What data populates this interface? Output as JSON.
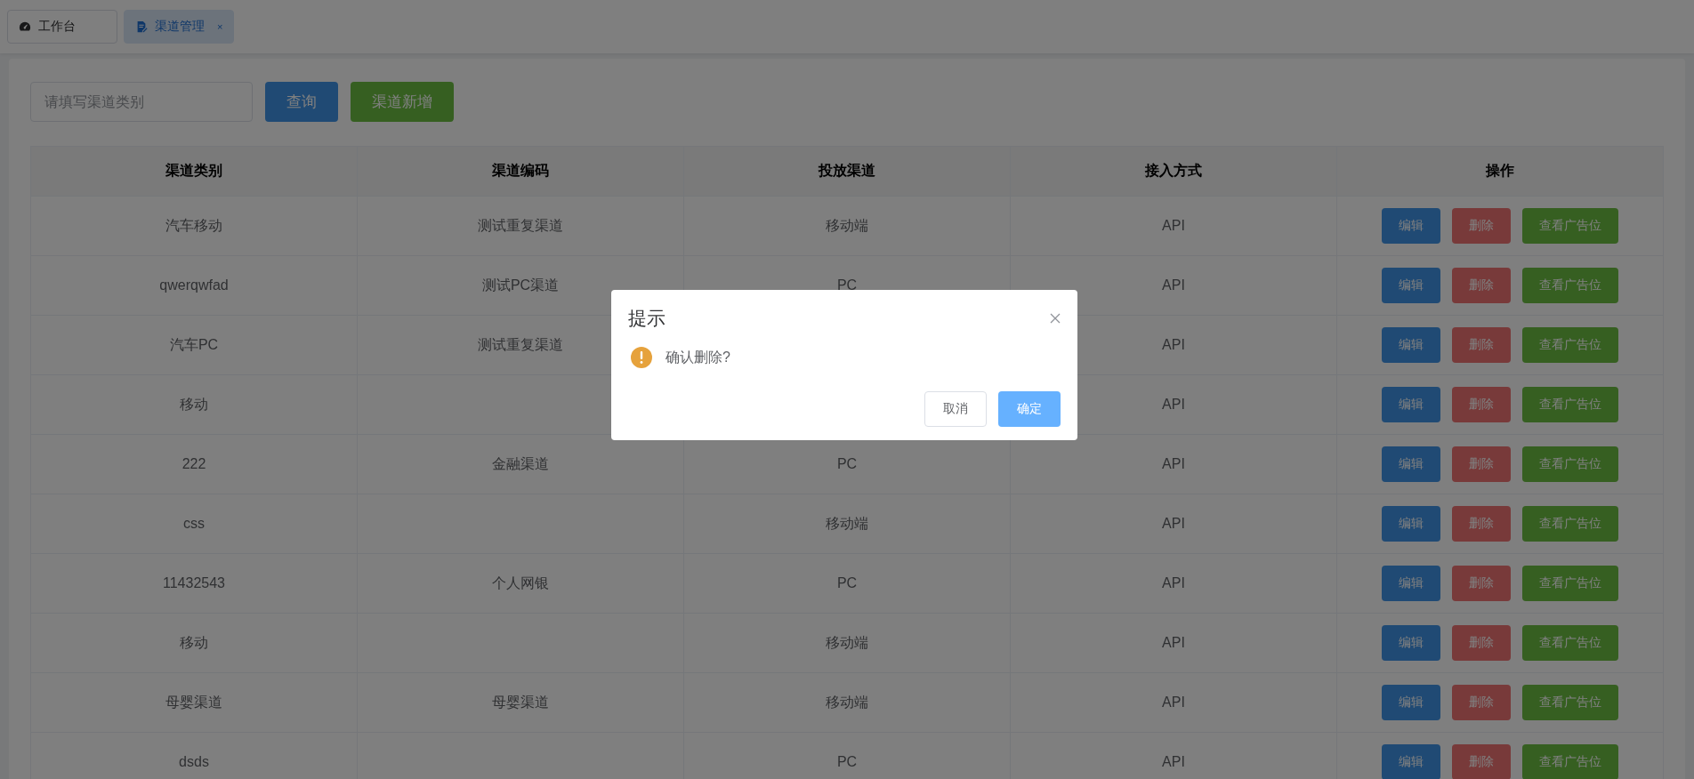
{
  "tabs": [
    {
      "label": "工作台",
      "selected": false
    },
    {
      "label": "渠道管理",
      "selected": true,
      "close": "×"
    }
  ],
  "toolbar": {
    "search": {
      "placeholder": "请填写渠道类别"
    },
    "buttons": [
      {
        "label": "查询",
        "kind": "primary"
      },
      {
        "label": "渠道新增",
        "kind": "success"
      }
    ]
  },
  "table": {
    "columns": [
      "渠道类别",
      "渠道编码",
      "投放渠道",
      "接入方式",
      "操作"
    ],
    "rows": [
      {
        "cells": [
          "汽车移动",
          "测试重复渠道",
          "移动端",
          "API"
        ],
        "actions": [
          {
            "label": "编辑",
            "kind": "primary"
          },
          {
            "label": "删除",
            "kind": "danger"
          },
          {
            "label": "查看广告位",
            "kind": "success"
          }
        ]
      },
      {
        "cells": [
          "qwerqwfad",
          "测试PC渠道",
          "PC",
          "API"
        ],
        "actions": [
          {
            "label": "编辑",
            "kind": "primary"
          },
          {
            "label": "删除",
            "kind": "danger"
          },
          {
            "label": "查看广告位",
            "kind": "success"
          }
        ]
      },
      {
        "cells": [
          "汽车PC",
          "测试重复渠道",
          null,
          "API"
        ],
        "actions": [
          {
            "label": "编辑",
            "kind": "primary"
          },
          {
            "label": "删除",
            "kind": "danger"
          },
          {
            "label": "查看广告位",
            "kind": "success"
          }
        ]
      },
      {
        "cells": [
          "移动",
          null,
          null,
          "API"
        ],
        "actions": [
          {
            "label": "编辑",
            "kind": "primary"
          },
          {
            "label": "删除",
            "kind": "danger"
          },
          {
            "label": "查看广告位",
            "kind": "success"
          }
        ]
      },
      {
        "cells": [
          "222",
          "金融渠道",
          "PC",
          "API"
        ],
        "actions": [
          {
            "label": "编辑",
            "kind": "primary"
          },
          {
            "label": "删除",
            "kind": "danger"
          },
          {
            "label": "查看广告位",
            "kind": "success"
          }
        ]
      },
      {
        "cells": [
          "css",
          null,
          "移动端",
          "API"
        ],
        "actions": [
          {
            "label": "编辑",
            "kind": "primary"
          },
          {
            "label": "删除",
            "kind": "danger"
          },
          {
            "label": "查看广告位",
            "kind": "success"
          }
        ]
      },
      {
        "cells": [
          "11432543",
          "个人网银",
          "PC",
          "API"
        ],
        "actions": [
          {
            "label": "编辑",
            "kind": "primary"
          },
          {
            "label": "删除",
            "kind": "danger"
          },
          {
            "label": "查看广告位",
            "kind": "success"
          }
        ]
      },
      {
        "cells": [
          "移动",
          null,
          "移动端",
          "API"
        ],
        "actions": [
          {
            "label": "编辑",
            "kind": "primary"
          },
          {
            "label": "删除",
            "kind": "danger"
          },
          {
            "label": "查看广告位",
            "kind": "success"
          }
        ]
      },
      {
        "cells": [
          "母婴渠道",
          "母婴渠道",
          "移动端",
          "API"
        ],
        "actions": [
          {
            "label": "编辑",
            "kind": "primary"
          },
          {
            "label": "删除",
            "kind": "danger"
          },
          {
            "label": "查看广告位",
            "kind": "success"
          }
        ]
      },
      {
        "cells": [
          "dsds",
          null,
          "PC",
          "API"
        ],
        "actions": [
          {
            "label": "编辑",
            "kind": "primary"
          },
          {
            "label": "删除",
            "kind": "danger"
          },
          {
            "label": "查看广告位",
            "kind": "success"
          }
        ]
      }
    ]
  },
  "dialog": {
    "title": "提示",
    "message": "确认删除?",
    "kind": "warning",
    "buttons": [
      {
        "label": "取消",
        "kind": "default"
      },
      {
        "label": "确定",
        "kind": "primary"
      }
    ]
  }
}
